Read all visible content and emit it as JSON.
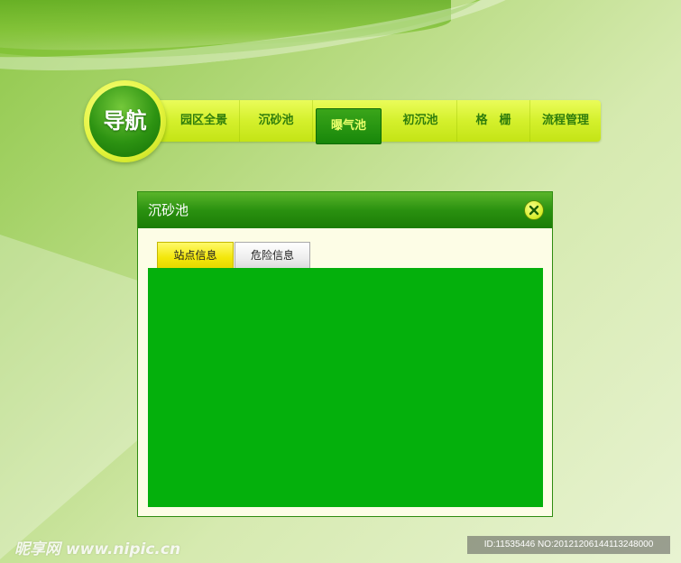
{
  "nav": {
    "logo_text": "导航",
    "items": [
      {
        "label": "园区全景"
      },
      {
        "label": "沉砂池"
      },
      {
        "label": "曝气池"
      },
      {
        "label": "初沉池"
      },
      {
        "label": "格　栅"
      },
      {
        "label": "流程管理"
      }
    ],
    "active_item": "曝气池"
  },
  "dialog": {
    "title": "沉砂池",
    "close_icon": "close-icon",
    "tabs": [
      {
        "label": "站点信息",
        "active": true
      },
      {
        "label": "危险信息",
        "active": false
      }
    ],
    "content_color": "#04b00c"
  },
  "watermark": {
    "brand": "昵享网 www.nipic.cn",
    "id_text": "ID:11535446 NO:20121206144113248000"
  },
  "colors": {
    "accent_green": "#1b7d06",
    "nav_yellow": "#d4f02c",
    "active_tab_yellow": "#f3e70a"
  }
}
